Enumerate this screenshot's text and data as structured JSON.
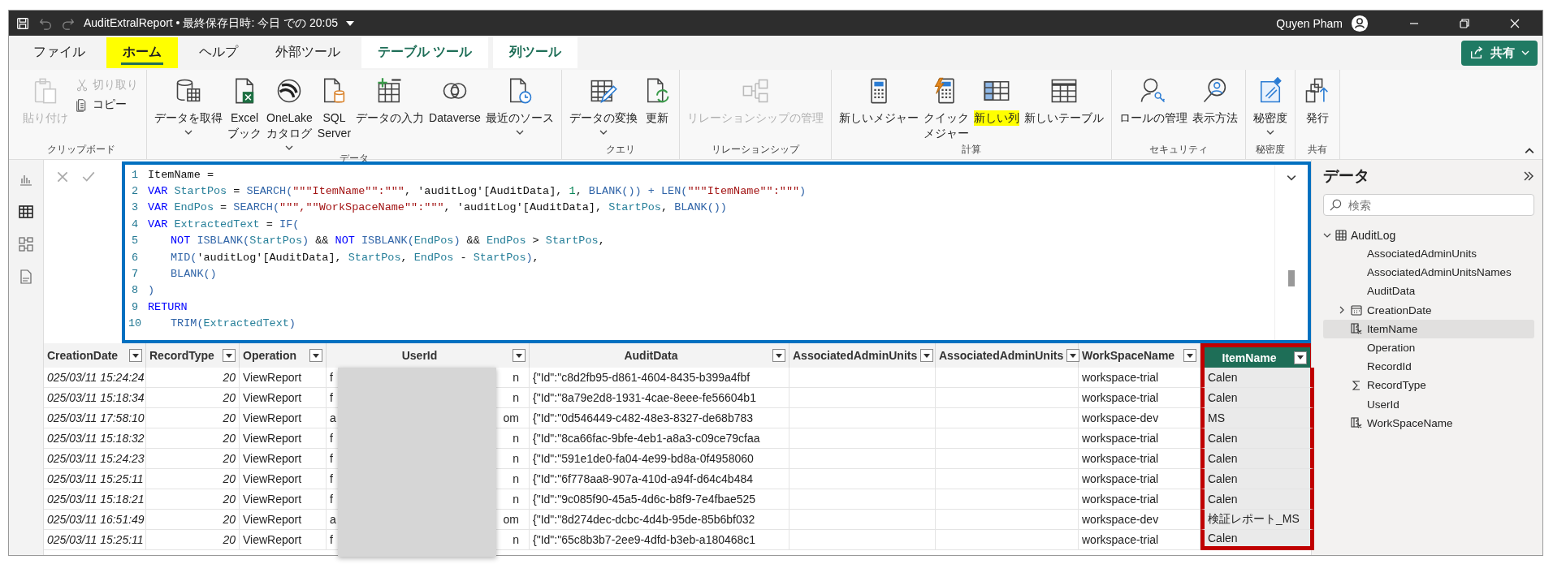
{
  "window": {
    "title": "AuditExtralReport • 最終保存日時: 今日 での 20:05",
    "user": "Quyen Pham"
  },
  "share_button": {
    "label": "共有"
  },
  "tabs": [
    {
      "label": "ファイル",
      "kind": "normal",
      "selected": false,
      "highlighted": false
    },
    {
      "label": "ホーム",
      "kind": "normal",
      "selected": true,
      "highlighted": true
    },
    {
      "label": "ヘルプ",
      "kind": "normal",
      "selected": false,
      "highlighted": false
    },
    {
      "label": "外部ツール",
      "kind": "normal",
      "selected": false,
      "highlighted": false
    },
    {
      "label": "テーブル ツール",
      "kind": "contextual",
      "selected": false,
      "highlighted": false
    },
    {
      "label": "列ツール",
      "kind": "contextual",
      "selected": false,
      "highlighted": false
    }
  ],
  "ribbon": {
    "groups": [
      {
        "label": "クリップボード",
        "items": [
          {
            "kind": "large",
            "lines": [
              "貼り付け"
            ],
            "disabled": true,
            "dropdown": false,
            "highlighted": false
          },
          {
            "kind": "stack",
            "items": [
              {
                "label": "切り取り",
                "disabled": true
              },
              {
                "label": "コピー",
                "disabled": false
              }
            ]
          }
        ]
      },
      {
        "label": "データ",
        "items": [
          {
            "kind": "large",
            "lines": [
              "データを取得"
            ],
            "disabled": false,
            "dropdown": true,
            "highlighted": false
          },
          {
            "kind": "large",
            "lines": [
              "Excel",
              "ブック"
            ],
            "disabled": false,
            "dropdown": false,
            "highlighted": false
          },
          {
            "kind": "large",
            "lines": [
              "OneLake",
              "カタログ"
            ],
            "disabled": false,
            "dropdown": true,
            "highlighted": false
          },
          {
            "kind": "large",
            "lines": [
              "SQL",
              "Server"
            ],
            "disabled": false,
            "dropdown": false,
            "highlighted": false
          },
          {
            "kind": "large",
            "lines": [
              "データの入力"
            ],
            "disabled": false,
            "dropdown": false,
            "highlighted": false
          },
          {
            "kind": "large",
            "lines": [
              "Dataverse"
            ],
            "disabled": false,
            "dropdown": false,
            "highlighted": false
          },
          {
            "kind": "large",
            "lines": [
              "最近のソース"
            ],
            "disabled": false,
            "dropdown": true,
            "highlighted": false
          }
        ]
      },
      {
        "label": "クエリ",
        "items": [
          {
            "kind": "large",
            "lines": [
              "データの変換"
            ],
            "disabled": false,
            "dropdown": true,
            "highlighted": false
          },
          {
            "kind": "large",
            "lines": [
              "更新"
            ],
            "disabled": false,
            "dropdown": false,
            "highlighted": false
          }
        ]
      },
      {
        "label": "リレーションシップ",
        "items": [
          {
            "kind": "large",
            "lines": [
              "リレーションシップの管理"
            ],
            "disabled": true,
            "dropdown": false,
            "highlighted": false
          }
        ]
      },
      {
        "label": "計算",
        "items": [
          {
            "kind": "large",
            "lines": [
              "新しいメジャー"
            ],
            "disabled": false,
            "dropdown": false,
            "highlighted": false
          },
          {
            "kind": "large",
            "lines": [
              "クイック",
              "メジャー"
            ],
            "disabled": false,
            "dropdown": false,
            "highlighted": false
          },
          {
            "kind": "large",
            "lines": [
              "新しい列"
            ],
            "disabled": false,
            "dropdown": false,
            "highlighted": true
          },
          {
            "kind": "large",
            "lines": [
              "新しいテーブル"
            ],
            "disabled": false,
            "dropdown": false,
            "highlighted": false
          }
        ]
      },
      {
        "label": "セキュリティ",
        "items": [
          {
            "kind": "large",
            "lines": [
              "ロールの管理"
            ],
            "disabled": false,
            "dropdown": false,
            "highlighted": false
          },
          {
            "kind": "large",
            "lines": [
              "表示方法"
            ],
            "disabled": false,
            "dropdown": false,
            "highlighted": false
          }
        ]
      },
      {
        "label": "秘密度",
        "items": [
          {
            "kind": "large",
            "lines": [
              "秘密度"
            ],
            "disabled": false,
            "dropdown": true,
            "highlighted": false
          }
        ]
      },
      {
        "label": "共有",
        "items": [
          {
            "kind": "large",
            "lines": [
              "発行"
            ],
            "disabled": false,
            "dropdown": false,
            "highlighted": false
          }
        ]
      }
    ]
  },
  "editor": {
    "lines": [
      {
        "number": "1",
        "indented": false,
        "tokens": [
          {
            "kind": "plain",
            "text": "ItemName ="
          }
        ]
      },
      {
        "number": "2",
        "indented": false,
        "tokens": [
          {
            "kind": "kw",
            "text": "VAR "
          },
          {
            "kind": "var",
            "text": "StartPos"
          },
          {
            "kind": "plain",
            "text": " = "
          },
          {
            "kind": "fn",
            "text": "SEARCH("
          },
          {
            "kind": "str",
            "text": "\"\"\"ItemName\"\":\"\"\""
          },
          {
            "kind": "plain",
            "text": ", 'auditLog'[AuditData], "
          },
          {
            "kind": "num",
            "text": "1"
          },
          {
            "kind": "plain",
            "text": ", "
          },
          {
            "kind": "fn",
            "text": "BLANK()) + LEN("
          },
          {
            "kind": "str",
            "text": "\"\"\"ItemName\"\":\"\"\""
          },
          {
            "kind": "fn",
            "text": ")"
          }
        ]
      },
      {
        "number": "3",
        "indented": false,
        "tokens": [
          {
            "kind": "kw",
            "text": "VAR "
          },
          {
            "kind": "var",
            "text": "EndPos"
          },
          {
            "kind": "plain",
            "text": " = "
          },
          {
            "kind": "fn",
            "text": "SEARCH("
          },
          {
            "kind": "str",
            "text": "\"\"\",\"\"WorkSpaceName\"\":\"\"\""
          },
          {
            "kind": "plain",
            "text": ", 'auditLog'[AuditData], "
          },
          {
            "kind": "var",
            "text": "StartPos"
          },
          {
            "kind": "plain",
            "text": ", "
          },
          {
            "kind": "fn",
            "text": "BLANK())"
          }
        ]
      },
      {
        "number": "4",
        "indented": false,
        "tokens": [
          {
            "kind": "kw",
            "text": "VAR "
          },
          {
            "kind": "var",
            "text": "ExtractedText"
          },
          {
            "kind": "plain",
            "text": " = "
          },
          {
            "kind": "fn",
            "text": "IF("
          }
        ]
      },
      {
        "number": "5",
        "indented": true,
        "tokens": [
          {
            "kind": "kw",
            "text": "NOT "
          },
          {
            "kind": "fn",
            "text": "ISBLANK("
          },
          {
            "kind": "var",
            "text": "StartPos"
          },
          {
            "kind": "fn",
            "text": ")"
          },
          {
            "kind": "plain",
            "text": " && "
          },
          {
            "kind": "kw",
            "text": "NOT "
          },
          {
            "kind": "fn",
            "text": "ISBLANK("
          },
          {
            "kind": "var",
            "text": "EndPos"
          },
          {
            "kind": "fn",
            "text": ")"
          },
          {
            "kind": "plain",
            "text": " && "
          },
          {
            "kind": "var",
            "text": "EndPos"
          },
          {
            "kind": "plain",
            "text": " > "
          },
          {
            "kind": "var",
            "text": "StartPos"
          },
          {
            "kind": "plain",
            "text": ","
          }
        ]
      },
      {
        "number": "6",
        "indented": true,
        "tokens": [
          {
            "kind": "fn",
            "text": "MID("
          },
          {
            "kind": "plain",
            "text": "'auditLog'[AuditData], "
          },
          {
            "kind": "var",
            "text": "StartPos"
          },
          {
            "kind": "plain",
            "text": ", "
          },
          {
            "kind": "var",
            "text": "EndPos"
          },
          {
            "kind": "plain",
            "text": " - "
          },
          {
            "kind": "var",
            "text": "StartPos"
          },
          {
            "kind": "fn",
            "text": ")"
          },
          {
            "kind": "plain",
            "text": ","
          }
        ]
      },
      {
        "number": "7",
        "indented": true,
        "tokens": [
          {
            "kind": "fn",
            "text": "BLANK()"
          }
        ]
      },
      {
        "number": "8",
        "indented": false,
        "tokens": [
          {
            "kind": "fn",
            "text": ")"
          }
        ]
      },
      {
        "number": "9",
        "indented": false,
        "tokens": [
          {
            "kind": "kw",
            "text": "RETURN"
          }
        ]
      },
      {
        "number": "10",
        "indented": true,
        "tokens": [
          {
            "kind": "fn",
            "text": "TRIM("
          },
          {
            "kind": "var",
            "text": "ExtractedText"
          },
          {
            "kind": "fn",
            "text": ")"
          }
        ]
      }
    ]
  },
  "table": {
    "columns": [
      {
        "label": "CreationDate",
        "selected": false
      },
      {
        "label": "RecordType",
        "selected": false
      },
      {
        "label": "Operation",
        "selected": false
      },
      {
        "label": "UserId",
        "selected": false
      },
      {
        "label": "AuditData",
        "selected": false
      },
      {
        "label": "AssociatedAdminUnits",
        "selected": false
      },
      {
        "label": "AssociatedAdminUnits",
        "selected": false
      },
      {
        "label": "WorkSpaceName",
        "selected": false
      },
      {
        "label": "ItemName",
        "selected": true
      }
    ],
    "rows": [
      {
        "creation_date": "025/03/11 15:24:24",
        "record_type": "20",
        "operation": "ViewReport",
        "user_id_start": "f",
        "user_id_end": "n",
        "audit_data": "{\"Id\":\"c8d2fb95-d861-4604-8435-b399a4fbf",
        "workspace_name": "workspace-trial",
        "item_name": "Calen"
      },
      {
        "creation_date": "025/03/11 15:18:34",
        "record_type": "20",
        "operation": "ViewReport",
        "user_id_start": "f",
        "user_id_end": "n",
        "audit_data": "{\"Id\":\"8a79e2d8-1931-4cae-8eee-fe56604b1",
        "workspace_name": "workspace-trial",
        "item_name": "Calen"
      },
      {
        "creation_date": "025/03/11 17:58:10",
        "record_type": "20",
        "operation": "ViewReport",
        "user_id_start": "a",
        "user_id_end": "om",
        "audit_data": "{\"Id\":\"0d546449-c482-48e3-8327-de68b783",
        "workspace_name": "workspace-dev",
        "item_name": "MS"
      },
      {
        "creation_date": "025/03/11 15:18:32",
        "record_type": "20",
        "operation": "ViewReport",
        "user_id_start": "f",
        "user_id_end": "n",
        "audit_data": "{\"Id\":\"8ca66fac-9bfe-4eb1-a8a3-c09ce79cfaa",
        "workspace_name": "workspace-trial",
        "item_name": "Calen"
      },
      {
        "creation_date": "025/03/11 15:24:23",
        "record_type": "20",
        "operation": "ViewReport",
        "user_id_start": "f",
        "user_id_end": "n",
        "audit_data": "{\"Id\":\"591e1de0-fa04-4e99-bd8a-0f4958060",
        "workspace_name": "workspace-trial",
        "item_name": "Calen"
      },
      {
        "creation_date": "025/03/11 15:25:11",
        "record_type": "20",
        "operation": "ViewReport",
        "user_id_start": "f",
        "user_id_end": "n",
        "audit_data": "{\"Id\":\"6f778aa8-907a-410d-a94f-d64c4b484",
        "workspace_name": "workspace-trial",
        "item_name": "Calen"
      },
      {
        "creation_date": "025/03/11 15:18:21",
        "record_type": "20",
        "operation": "ViewReport",
        "user_id_start": "f",
        "user_id_end": "n",
        "audit_data": "{\"Id\":\"9c085f90-45a5-4d6c-b8f9-7e4fbae525",
        "workspace_name": "workspace-trial",
        "item_name": "Calen"
      },
      {
        "creation_date": "025/03/11 16:51:49",
        "record_type": "20",
        "operation": "ViewReport",
        "user_id_start": "a",
        "user_id_end": "om",
        "audit_data": "{\"Id\":\"8d274dec-dcbc-4d4b-95de-85b6bf032",
        "workspace_name": "workspace-dev",
        "item_name": "検証レポート_MS"
      },
      {
        "creation_date": "025/03/11 15:25:11",
        "record_type": "20",
        "operation": "ViewReport",
        "user_id_start": "f",
        "user_id_end": "n",
        "audit_data": "{\"Id\":\"65c8b3b7-2ee9-4dfd-b3eb-a180468c1",
        "workspace_name": "workspace-trial",
        "item_name": "Calen"
      }
    ]
  },
  "data_pane": {
    "title": "データ",
    "search": {
      "placeholder": "検索"
    },
    "tree": [
      {
        "label": "AuditLog",
        "kind": "table",
        "expanded": true,
        "children": [
          {
            "label": "AssociatedAdminUnits",
            "kind": "field",
            "selected": false
          },
          {
            "label": "AssociatedAdminUnitsNames",
            "kind": "field",
            "selected": false
          },
          {
            "label": "AuditData",
            "kind": "field",
            "selected": false
          },
          {
            "label": "CreationDate",
            "kind": "date",
            "selected": false
          },
          {
            "label": "ItemName",
            "kind": "calculated",
            "selected": true
          },
          {
            "label": "Operation",
            "kind": "field",
            "selected": false
          },
          {
            "label": "RecordId",
            "kind": "field",
            "selected": false
          },
          {
            "label": "RecordType",
            "kind": "sum",
            "selected": false
          },
          {
            "label": "UserId",
            "kind": "field",
            "selected": false
          },
          {
            "label": "WorkSpaceName",
            "kind": "calculated",
            "selected": false
          }
        ]
      }
    ]
  }
}
